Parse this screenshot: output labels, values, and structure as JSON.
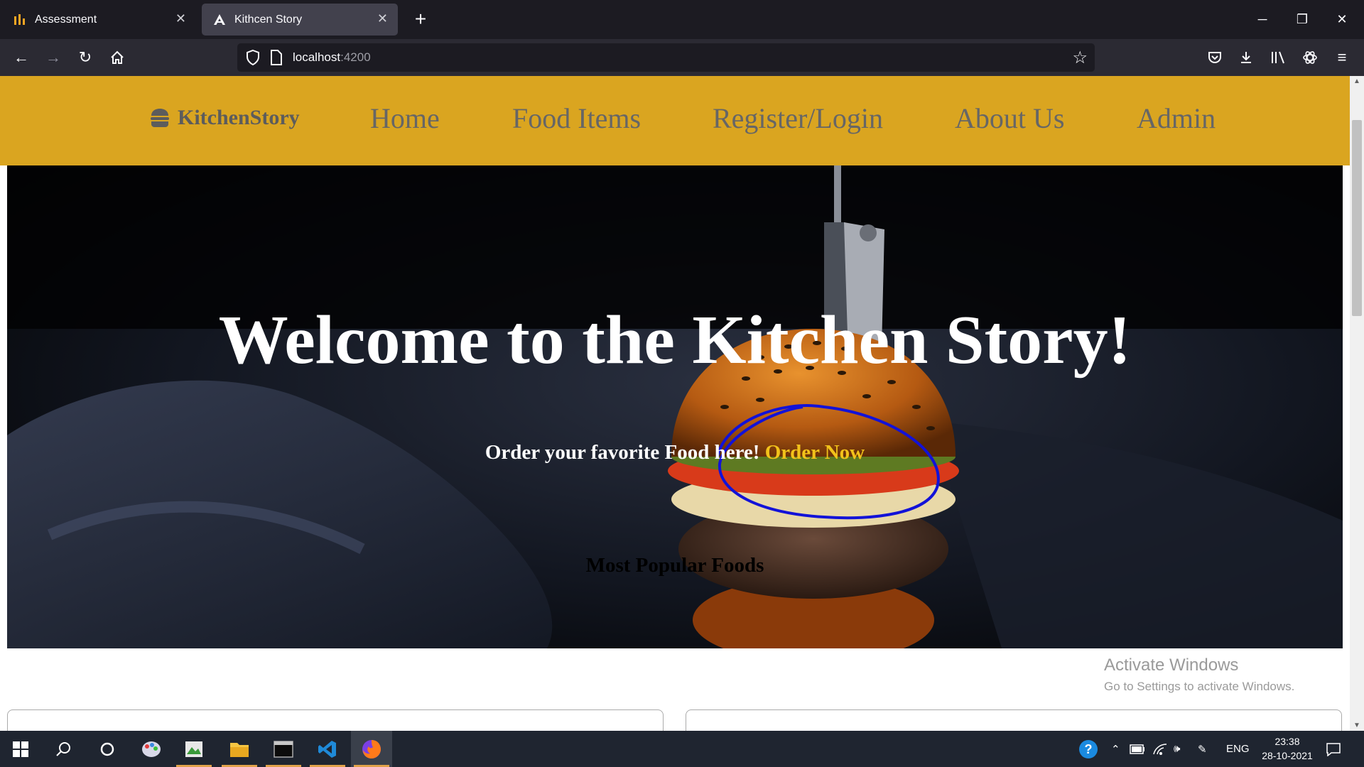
{
  "browser": {
    "tabs": [
      {
        "title": "Assessment",
        "active": false
      },
      {
        "title": "Kithcen Story",
        "active": true
      }
    ],
    "url": {
      "host": "localhost",
      "port": ":4200"
    },
    "window_controls": [
      "minimize",
      "restore",
      "close"
    ]
  },
  "site": {
    "brand": "KitchenStory",
    "nav": [
      "Home",
      "Food Items",
      "Register/Login",
      "About Us",
      "Admin"
    ],
    "hero": {
      "title": "Welcome to the Kitchen Story!",
      "subtitle": "Order your favorite Food here!",
      "cta": "Order Now"
    },
    "section_title": "Most Popular Foods"
  },
  "watermark": {
    "line1": "Activate Windows",
    "line2": "Go to Settings to activate Windows."
  },
  "taskbar": {
    "language": "ENG",
    "time": "23:38",
    "date": "28-10-2021"
  },
  "colors": {
    "nav_bg": "#daa520",
    "cta": "#f2c21a",
    "annotation": "#1212d8"
  }
}
